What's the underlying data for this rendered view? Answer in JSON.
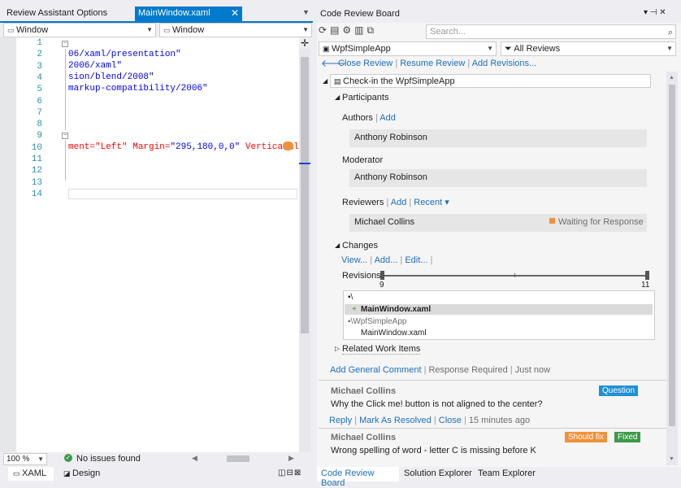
{
  "left_tabs": {
    "inactive": "Review Assistant Options",
    "active": "MainWindow.xaml"
  },
  "dropdowns": {
    "left": "Window",
    "right": "Window"
  },
  "line_numbers": [
    "1",
    "2",
    "3",
    "4",
    "5",
    "6",
    "7",
    "8",
    "9",
    "10",
    "11",
    "12",
    "13",
    "14"
  ],
  "code_lines": [
    {
      "line": "2",
      "text": "06/xaml/presentation\""
    },
    {
      "line": "3",
      "text": "2006/xaml\""
    },
    {
      "line": "4",
      "text": "sion/blend/2008\""
    },
    {
      "line": "5",
      "text": "markup-compatibility/2006\""
    },
    {
      "line": "10",
      "text_a": "ment=\"Left\"",
      "text_b": " Margin=",
      "text_c": "\"295,180,0,0\"",
      "text_d": " VerticalAli"
    }
  ],
  "status": {
    "zoom": "100 %",
    "issues": "No issues found"
  },
  "view_tabs": {
    "xaml": "XAML",
    "design": "Design"
  },
  "panel": {
    "title": "Code Review Board",
    "search_placeholder": "Search...",
    "project": "WpfSimpleApp",
    "filter": "All Reviews",
    "actions": {
      "close": "Close Review",
      "resume": "Resume Review",
      "add_revisions": "Add Revisions..."
    },
    "review_title": "Check-in the WpfSimpleApp",
    "participants": "Participants",
    "authors_label": "Authors",
    "add": "Add",
    "author": "Anthony Robinson",
    "moderator_label": "Moderator",
    "moderator": "Anthony Robinson",
    "reviewers_label": "Reviewers",
    "recent": "Recent ▾",
    "reviewer": "Michael Collins",
    "reviewer_status": "Waiting for Response",
    "changes": "Changes",
    "view": "View...",
    "add_dots": "Add...",
    "edit": "Edit...",
    "revisions_label": "Revisions:",
    "rev_min": "9",
    "rev_max": "11",
    "tree": {
      "root": "\\",
      "file1": "MainWindow.xaml",
      "folder": "\\WpfSimpleApp",
      "file2": "MainWindow.xaml"
    },
    "related": "Related Work Items",
    "comment_bar": {
      "add": "Add General Comment",
      "response": "Response Required",
      "just_now": "Just now"
    },
    "comments": [
      {
        "author": "Michael Collins",
        "text": "Why the Click me! button is not aligned to the center?",
        "badge": "Question",
        "reply": "Reply",
        "resolve": "Mark As Resolved",
        "close": "Close",
        "time": "15 minutes ago"
      },
      {
        "author": "Michael Collins",
        "text": "Wrong spelling of word - letter C is missing before K",
        "badge1": "Should fix",
        "badge2": "Fixed"
      }
    ]
  },
  "bottom_tabs": {
    "crb": "Code Review Board",
    "se": "Solution Explorer",
    "te": "Team Explorer"
  },
  "colors": {
    "accent": "#007acc",
    "link": "#1e6fbe",
    "question": "#1e90d6",
    "should_fix": "#f0913a",
    "fixed": "#3c9a48"
  }
}
